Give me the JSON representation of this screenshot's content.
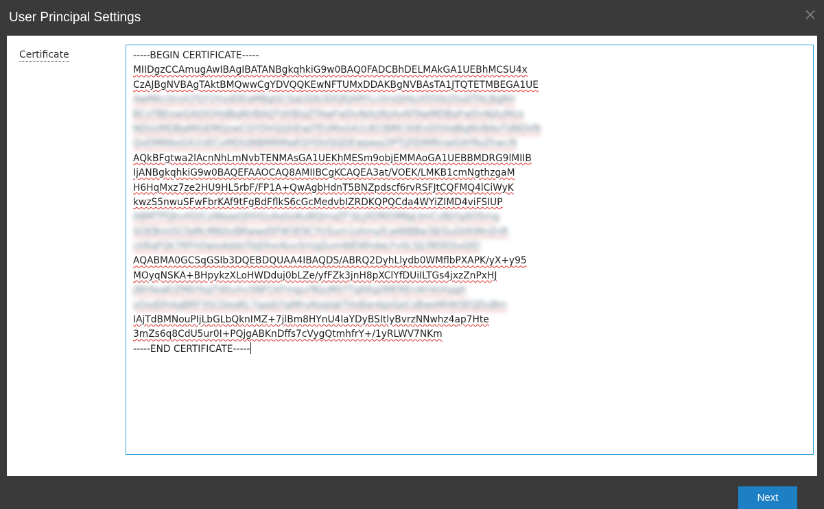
{
  "dialog": {
    "title": "User Principal Settings",
    "close_label": "×"
  },
  "form": {
    "certificate_label": "Certificate",
    "certificate_lines": [
      {
        "text": "-----BEGIN CERTIFICATE-----",
        "style": "plain"
      },
      {
        "text": "MIIDgzCCAmugAwIBAgIBATANBgkqhkiG9w0BAQ0FADCBhDELMAkGA1UEBhMCSU4x",
        "style": "spell"
      },
      {
        "text": "CzAJBgNVBAgTAktBMQwwCgYDVQQKEwNFTUMxDDAKBgNVBAsTA1JTQTETMBEGA1UE",
        "style": "spell"
      },
      {
        "text": "AwMKcGrsX25jY2VydDEaMBgGCSqGSIb3DQEJARYLcGrsQHJuX55tb20uDTALBgNV",
        "style": "blurred"
      },
      {
        "text": "BCsTBEowGAtDOHdBgNVBAQTdXBlaZTAwFwDvNjAzNzAxNTAwMDBaFwDvNjAzMzx",
        "style": "blurred"
      },
      {
        "text": "NDUzMDBaMIGEMQswCQYDVQQGEwJTEUMxGA1UECBMCS0ExDOHdBgNVBAoTdNDVN",
        "style": "blurred"
      },
      {
        "text": "QxEMMAoGA1UECxMDUjNBMRMwEQYDVQQDEwpwa2lPTjZlDlMRnwGAYRoZhwcN",
        "style": "blurred"
      },
      {
        "text": "AQkBFgtwa2lAcnNhLmNvbTENMAsGA1UEKhMESm9objEMMAoGA1UEBBMDRG9lMIIB",
        "style": "spell"
      },
      {
        "text": "IjANBgkqhkiG9w0BAQEFAAOCAQ8AMIIBCgKCAQEA3at/VOEK/LMKB1cmNgthzgaM",
        "style": "spell"
      },
      {
        "text": "H6HqMxz7ze2HU9HL5rbF/FP1A+QwAgbHdnT5BNZpdscf6rvRSFJtCQFMQ4lCiWyK",
        "style": "spell"
      },
      {
        "text": "kwzS5nwuSFwFbrKAf9tFgBdFflkS6cGcMedvbIZRDKQPQCda4WYiZIMD4viFSIUP",
        "style": "spell"
      },
      {
        "text": "ABMTPQkvXGlCyWaaeQhhGuAaSoKuNQmaZF3jLJXDNS9MgLbnCuNjYgAOSmg",
        "style": "blurred"
      },
      {
        "text": "SOEBmt5CfaMcMNXxBRwwd5FW3E9CYt/Sum1ohmyfLwWBBw38/SuGHhMnZnR",
        "style": "blurred"
      },
      {
        "text": "ckRqFQk7RFhOwisAddsTkJDhsrKuvSrUgSumWEWhdaLFvSL5JLfN5EDuQID",
        "style": "blurred"
      },
      {
        "text": "AQABMA0GCSqGSIb3DQEBDQUAA4IBAQDS/ABRQ2DyhLlydb0WMflbPXAPK/yX+y95",
        "style": "spell"
      },
      {
        "text": "MOyqNSKA+BHpykzXLoHWDduj0bLZe/yfFZk3jnH8pXClYfDUiILTGs4jxzZnPxHJ",
        "style": "spell"
      },
      {
        "text": "jNhfwaKiZMbYkgTdGuhvSNFCkFmgurfKJuMSTTgRKgilMEREnAhVoXagA",
        "style": "blurred"
      },
      {
        "text": "yGsdDhAgBRF3SCDeqRL7gqdLYgMhyKoglqkT0sBardgsGpCsBweMHKSEQDuBm",
        "style": "blurred"
      },
      {
        "text": "IAjTdBMNouPIjLbGLbQknIMZ+7jlBm8HYnU4laYDyBSItlyBvrzNNwhz4ap7Hte",
        "style": "spell"
      },
      {
        "text": "3mZs6q8CdU5ur0I+PQjgABKnDffs7cVygQtmhfrY+/1yRLWV7NKm",
        "style": "spell"
      },
      {
        "text": "-----END CERTIFICATE-----",
        "style": "plain"
      }
    ]
  },
  "footer": {
    "next_label": "Next"
  },
  "colors": {
    "title_bar": "#3a3a3a",
    "content_bg": "#ffffff",
    "textarea_border": "#2f9fd8",
    "next_button": "#1d7fc4",
    "spellcheck_underline": "#e03030"
  }
}
